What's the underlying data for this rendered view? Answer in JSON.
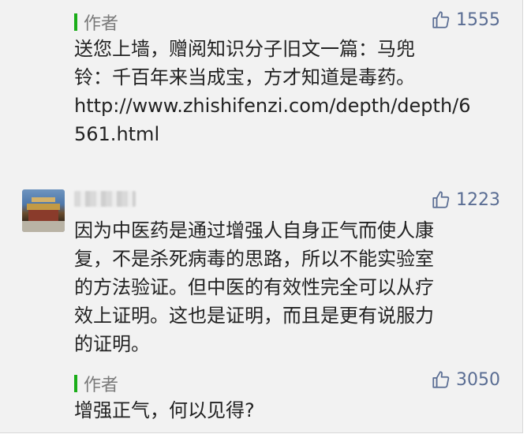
{
  "comments": [
    {
      "author_label": "作者",
      "likes": "1555",
      "lines": [
        "送您上墙，赠阅知识分子旧文一篇：马兜",
        "铃：千百年来当成宝，方才知道是毒药。",
        "http://www.zhishifenzi.com/depth/depth/6",
        "561.html"
      ]
    },
    {
      "likes": "1223",
      "lines": [
        "因为中医药是通过增强人自身正气而使人康",
        "复，不是杀死病毒的思路，所以不能实验室",
        "的方法验证。但中医的有效性完全可以从疗",
        "效上证明。这也是证明，而且是更有说服力",
        "的证明。"
      ]
    },
    {
      "author_label": "作者",
      "likes": "3050",
      "lines": [
        "增强正气，何以见得?"
      ]
    }
  ],
  "icons": {
    "like": "thumbs-up-outline-icon"
  },
  "colors": {
    "author_bar": "#1aad19",
    "like": "#5a6d93",
    "panel_bg": "#f2f2f2"
  }
}
